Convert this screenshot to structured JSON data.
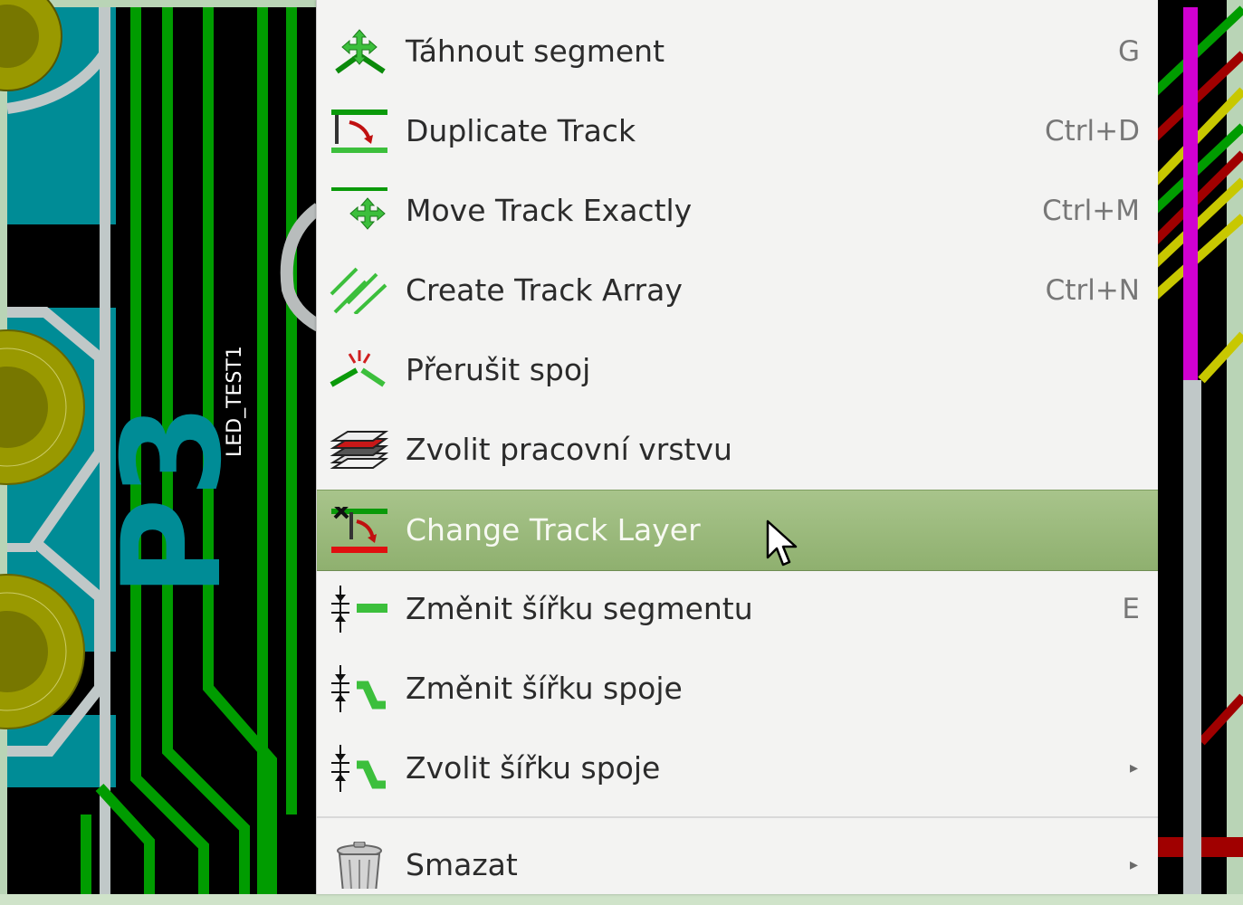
{
  "pcb": {
    "reference_label": "P3",
    "net_label": "LED_TEST1"
  },
  "context_menu": {
    "items": [
      {
        "label": "Táhnout segment",
        "shortcut": "G",
        "icon": "drag-segment-icon"
      },
      {
        "label": "Duplicate Track",
        "shortcut": "Ctrl+D",
        "icon": "duplicate-track-icon"
      },
      {
        "label": "Move Track Exactly",
        "shortcut": "Ctrl+M",
        "icon": "move-exactly-icon"
      },
      {
        "label": "Create Track Array",
        "shortcut": "Ctrl+N",
        "icon": "track-array-icon"
      },
      {
        "label": "Přerušit spoj",
        "shortcut": "",
        "icon": "break-track-icon"
      },
      {
        "label": "Zvolit pracovní vrstvu",
        "shortcut": "",
        "icon": "layers-icon"
      },
      {
        "label": "Change Track Layer",
        "shortcut": "",
        "icon": "change-layer-icon",
        "highlighted": true
      },
      {
        "label": "Změnit šířku segmentu",
        "shortcut": "E",
        "icon": "segment-width-icon"
      },
      {
        "label": "Změnit šířku spoje",
        "shortcut": "",
        "icon": "track-width-icon"
      },
      {
        "label": "Zvolit šířku spoje",
        "shortcut": "",
        "icon": "select-width-icon",
        "submenu": true
      },
      {
        "label": "Smazat",
        "shortcut": "",
        "icon": "trash-icon",
        "submenu": true
      }
    ],
    "submenu_arrow": "▸"
  },
  "colors": {
    "menu_bg": "#f3f3f2",
    "highlight": "#98b878",
    "pcb_background": "#000000",
    "track_green": "#009c00",
    "pad_teal": "#008c96",
    "pad_olive": "#999900",
    "track_magenta": "#d000d0",
    "track_yellow": "#c8c800",
    "track_red": "#a00000"
  }
}
